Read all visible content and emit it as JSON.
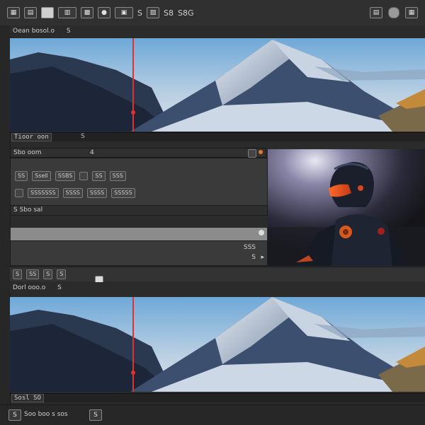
{
  "toolbar": {
    "icons": [
      "grid-icon",
      "image-icon",
      "square-icon",
      "layers-icon",
      "film-icon",
      "circle-icon",
      "export-icon",
      "sound-icon",
      "filter-icon",
      "settings-icon"
    ],
    "labels": [
      "S",
      "5",
      "S8",
      "S8G"
    ]
  },
  "top_panel": {
    "title": "Oean bosol.o",
    "title_tag": "S",
    "timecode": "Tioor oon",
    "strip_tag": "S"
  },
  "mid_bar": {
    "label": "Sbo oom",
    "num": "4"
  },
  "controls": {
    "row1": [
      "SS",
      "Ssell",
      "SSBS",
      "SS",
      "SSS"
    ],
    "row2": [
      "SSSSSSS",
      "SSSS",
      "SSSS",
      "SSSSS"
    ],
    "footer_label": "S Sbo sal",
    "progress": 1.0,
    "speed_label": "SSS",
    "speed_tag": "S"
  },
  "lower_toolbar": {
    "buttons": [
      "S",
      "SS",
      "S",
      "S"
    ]
  },
  "bottom_panel": {
    "title": "Dorl ooo.o",
    "title_tag": "S",
    "timecode": "Sosl SO"
  },
  "status_bar": {
    "left": "S",
    "label": "Soo boo s sos",
    "right": "S"
  },
  "colors": {
    "accent_red": "#e03030",
    "accent_orange": "#e07a2a",
    "bg": "#2b2b2b"
  }
}
